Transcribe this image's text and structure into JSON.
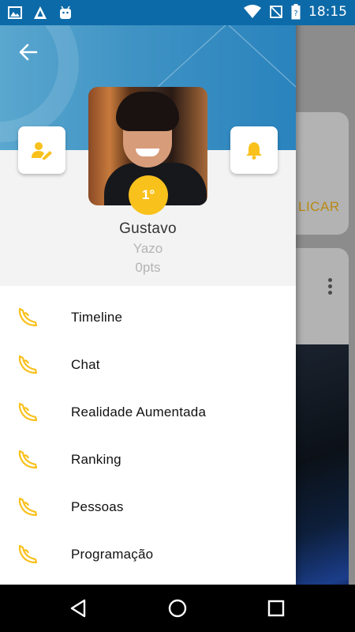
{
  "status_bar": {
    "time": "18:15",
    "left_icons": [
      "image-icon",
      "warning-a-icon",
      "android-icon"
    ],
    "right_icons": [
      "wifi-icon",
      "no-signal-icon",
      "battery-icon"
    ]
  },
  "background": {
    "publicar_label": "LICAR"
  },
  "drawer": {
    "user": {
      "name": "Gustavo",
      "organization": "Yazo",
      "points": "0pts",
      "rank": "1°"
    },
    "menu": [
      {
        "label": "Timeline",
        "icon": "banana-icon"
      },
      {
        "label": "Chat",
        "icon": "banana-icon"
      },
      {
        "label": "Realidade Aumentada",
        "icon": "banana-icon"
      },
      {
        "label": "Ranking",
        "icon": "banana-icon"
      },
      {
        "label": "Pessoas",
        "icon": "banana-icon"
      },
      {
        "label": "Programação",
        "icon": "banana-icon"
      }
    ]
  },
  "colors": {
    "accent": "#f9c11c",
    "header_blue": "#3f93c4",
    "status_bar": "#0d6aa8"
  }
}
